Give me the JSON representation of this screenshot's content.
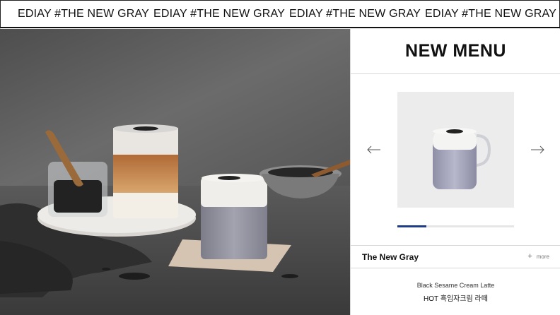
{
  "marquee": {
    "items": [
      "EDIAY #THE NEW GRAY",
      "EDIAY #THE NEW GRAY",
      "EDIAY #THE NEW GRAY",
      "EDIAY #THE NEW GRAY"
    ]
  },
  "panel": {
    "title": "NEW MENU",
    "carousel": {
      "progress_fraction": 0.25
    },
    "collection_title": "The New Gray",
    "more_label": "more",
    "product": {
      "name_en": "Black Sesame Cream Latte",
      "name_ko": "HOT 흑임자크림 라떼"
    }
  },
  "colors": {
    "accent": "#1f3c88",
    "latte_gray": "#9a9aa6",
    "hero_bg": "#5e5e5e"
  },
  "icons": {
    "prev": "arrow-left-icon",
    "next": "arrow-right-icon",
    "more": "plus-icon"
  }
}
